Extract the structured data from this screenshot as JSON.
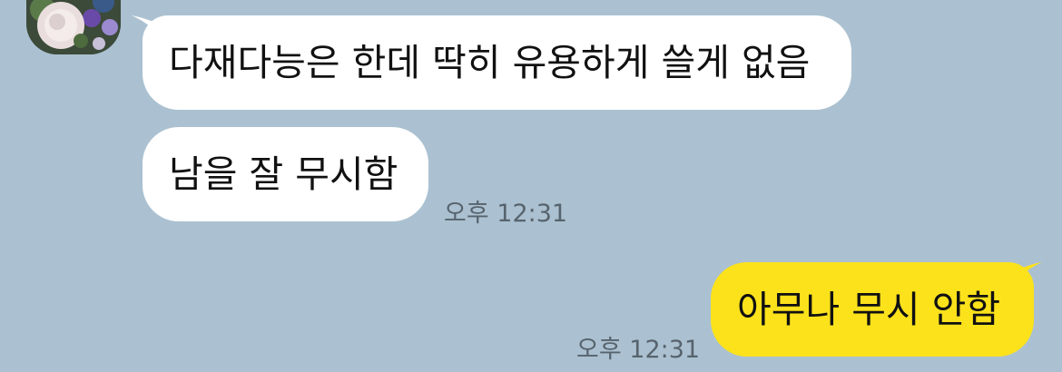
{
  "messages": [
    {
      "side": "received",
      "text": "다재다능은 한데 딱히 유용하게 쓸게 없음"
    },
    {
      "side": "received",
      "text": "남을 잘 무시함",
      "time": "오후 12:31"
    },
    {
      "side": "sent",
      "text": "아무나 무시 안함",
      "time": "오후 12:31"
    }
  ],
  "colors": {
    "background": "#abc1d1",
    "received_bubble": "#ffffff",
    "sent_bubble": "#fce21b",
    "timestamp_text": "#57636d"
  },
  "icons": {
    "avatar": "flower-bouquet-avatar"
  }
}
